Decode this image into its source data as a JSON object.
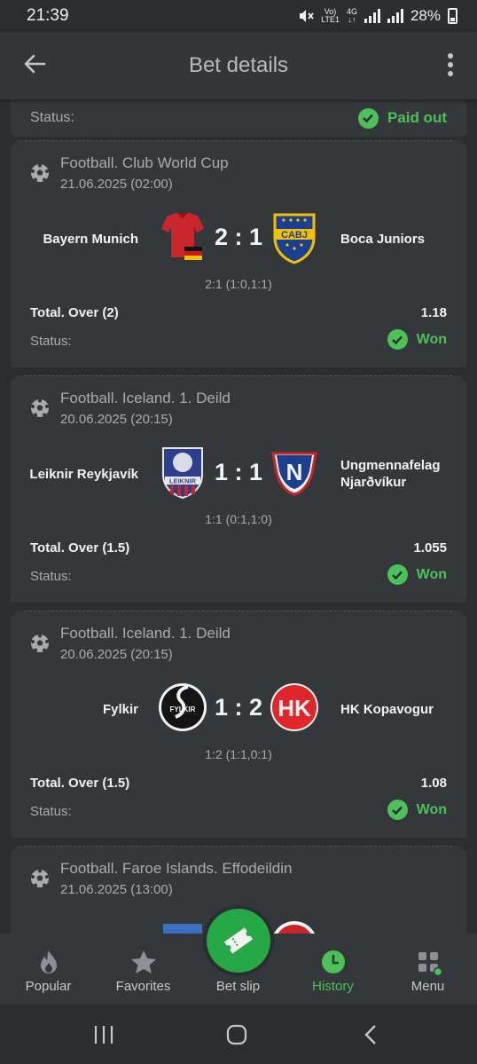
{
  "statusbar": {
    "time": "21:39",
    "volte_top": "Vo)",
    "volte_bottom": "LTE1",
    "net_top": "4G",
    "net_bottom": "↓↑",
    "battery": "28%"
  },
  "header": {
    "title": "Bet details"
  },
  "summary": {
    "status_label": "Status:",
    "status_value": "Paid out"
  },
  "bets": [
    {
      "league": "Football. Club World Cup",
      "date": "21.06.2025 (02:00)",
      "home": "Bayern Munich",
      "away": "Boca Juniors",
      "score": "2 : 1",
      "period": "2:1 (1:0,1:1)",
      "market": "Total. Over (2)",
      "odds": "1.18",
      "status_label": "Status:",
      "status_value": "Won",
      "away_logo_text": "CABJ"
    },
    {
      "league": "Football. Iceland. 1. Deild",
      "date": "20.06.2025 (20:15)",
      "home": "Leiknir Reykjavík",
      "away": "Ungmennafelag Njarðvíkur",
      "score": "1 : 1",
      "period": "1:1 (0:1,1:0)",
      "market": "Total. Over (1.5)",
      "odds": "1.055",
      "status_label": "Status:",
      "status_value": "Won",
      "home_logo_text": "LEIKNIR",
      "away_logo_text": "N"
    },
    {
      "league": "Football. Iceland. 1. Deild",
      "date": "20.06.2025 (20:15)",
      "home": "Fylkir",
      "away": "HK Kopavogur",
      "score": "1 : 2",
      "period": "1:2 (1:1,0:1)",
      "market": "Total. Over (1.5)",
      "odds": "1.08",
      "status_label": "Status:",
      "status_value": "Won",
      "home_logo_text": "FYLKIR",
      "away_logo_text": "HK"
    },
    {
      "league": "Football. Faroe Islands. Effodeildin",
      "date": "21.06.2025 (13:00)"
    }
  ],
  "nav": [
    {
      "label": "Popular",
      "icon": "flame-icon"
    },
    {
      "label": "Favorites",
      "icon": "star-icon"
    },
    {
      "label": "Bet slip",
      "icon": "ticket-icon"
    },
    {
      "label": "History",
      "icon": "clock-icon"
    },
    {
      "label": "Menu",
      "icon": "grid-icon"
    }
  ],
  "colors": {
    "accent": "#4cc159",
    "betslip": "#27a846",
    "background": "#2b2e31",
    "card": "#35383b"
  }
}
